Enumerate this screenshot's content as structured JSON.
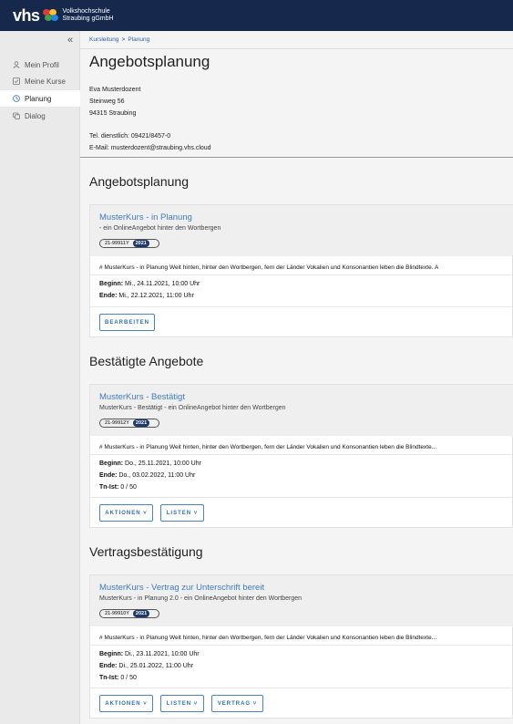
{
  "header": {
    "logo_text": "vhs",
    "org_line1": "Volkshochschule",
    "org_line2": "Straubing gGmbH",
    "colors": {
      "bar": "#16294d"
    }
  },
  "sidebar": {
    "collapse_glyph": "«",
    "items": [
      {
        "label": "Mein Profil",
        "icon": "user-icon",
        "active": false
      },
      {
        "label": "Meine Kurse",
        "icon": "checkbox-icon",
        "active": false
      },
      {
        "label": "Planung",
        "icon": "clock-icon",
        "active": true
      },
      {
        "label": "Dialog",
        "icon": "chat-icon",
        "active": false
      }
    ]
  },
  "breadcrumb": {
    "items": [
      "Kursleitung",
      "Planung"
    ],
    "separator": ">"
  },
  "page_title": "Angebotsplanung",
  "contact": {
    "name": "Eva Musterdozent",
    "street": "Steinweg 56",
    "city": "94315 Straubing",
    "phone": "Tel. dienstlich: 09421/8457-0",
    "email": "E-Mail: musterdozent@straubing.vhs.cloud"
  },
  "sections": [
    {
      "heading": "Angebotsplanung",
      "card": {
        "title": "MusterKurs - in Planung",
        "subtitle": "- ein OnlineAngebot hinter den Wortbergen",
        "code": "21-99911Y",
        "year": "2021",
        "description": "# MusterKurs - in Planung Weit hinten, hinter den Wortbergen, fern der Länder Vokalien und Konsonantien leben die Blindtexte. A",
        "begin_label": "Beginn:",
        "begin": "Mi., 24.11.2021, 10:00 Uhr",
        "end_label": "Ende:",
        "end": "Mi., 22.12.2021, 11:00 Uhr",
        "buttons": [
          "BEARBEITEN"
        ]
      }
    },
    {
      "heading": "Bestätigte Angebote",
      "card": {
        "title": "MusterKurs - Bestätigt",
        "subtitle": "MusterKurs - Bestätigt - ein OnlineAngebot hinter den Wortbergen",
        "code": "21-99912Y",
        "year": "2021",
        "description": "# MusterKurs - in Planung Weit hinten, hinter den Wortbergen, fern der Länder Vokalien und Konsonantien leben die Blindtexte...",
        "begin_label": "Beginn:",
        "begin": "Do., 25.11.2021, 10:00 Uhr",
        "end_label": "Ende:",
        "end": "Do., 03.02.2022, 11:00 Uhr",
        "tn_label": "Tn-Ist:",
        "tn": "0 / 50",
        "buttons": [
          "AKTIONEN ˅",
          "LISTEN ˅"
        ]
      }
    },
    {
      "heading": "Vertragsbestätigung",
      "card": {
        "title": "MusterKurs - Vertrag zur Unterschrift bereit",
        "subtitle": "MusterKurs - in Planung 2.0 - ein OnlineAngebot hinter den Wortbergen",
        "code": "21-99910Y",
        "year": "2021",
        "description": "# MusterKurs - in Planung Weit hinten, hinter den Wortbergen, fern der Länder Vokalien und Konsonantien leben die Blindtexte...",
        "begin_label": "Beginn:",
        "begin": "Di., 23.11.2021, 10:00 Uhr",
        "end_label": "Ende:",
        "end": "Di., 25.01.2022, 11:00 Uhr",
        "tn_label": "Tn-Ist:",
        "tn": "0 / 50",
        "buttons": [
          "AKTIONEN ˅",
          "LISTEN ˅",
          "VERTRAG ˅"
        ]
      }
    }
  ]
}
